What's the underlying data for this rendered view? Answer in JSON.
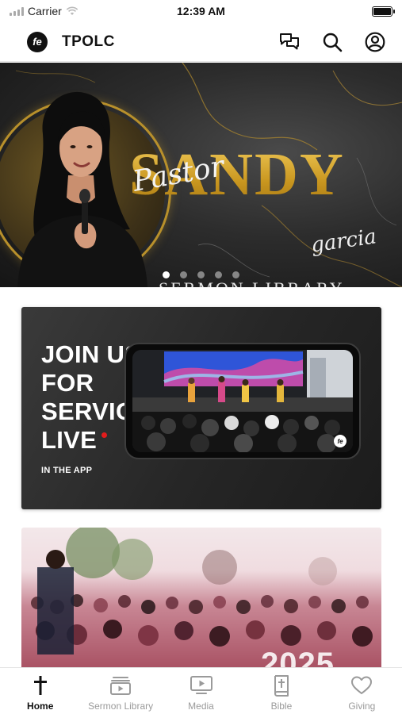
{
  "status_bar": {
    "carrier": "Carrier",
    "time": "12:39 AM"
  },
  "header": {
    "title": "TPOLC",
    "logo_text": "fe",
    "icons": [
      "chat-bubbles-icon",
      "search-icon",
      "account-icon"
    ]
  },
  "banner": {
    "script_top": "Pastor",
    "name": "SANDY",
    "script_bottom": "garcia",
    "subtitle": "SERMON LIBRARY",
    "slide_count": 5,
    "active_slide": 1
  },
  "live_card": {
    "heading_lines": [
      "JOIN US",
      "FOR",
      "SERVICE",
      "LIVE"
    ],
    "subheading": "IN THE APP",
    "phone_watermark": "fe"
  },
  "outreach_card": {
    "year_text": "2025"
  },
  "tab_bar": {
    "tabs": [
      {
        "label": "Home",
        "icon": "cross-icon",
        "active": true
      },
      {
        "label": "Sermon Library",
        "icon": "video-library-icon",
        "active": false
      },
      {
        "label": "Media",
        "icon": "tv-play-icon",
        "active": false
      },
      {
        "label": "Bible",
        "icon": "bible-icon",
        "active": false
      },
      {
        "label": "Giving",
        "icon": "heart-icon",
        "active": false
      }
    ]
  },
  "colors": {
    "accent_gold": "#d9a72e",
    "live_red": "#e21c1c",
    "tab_active": "#111111",
    "tab_inactive": "#9a9a9a"
  }
}
